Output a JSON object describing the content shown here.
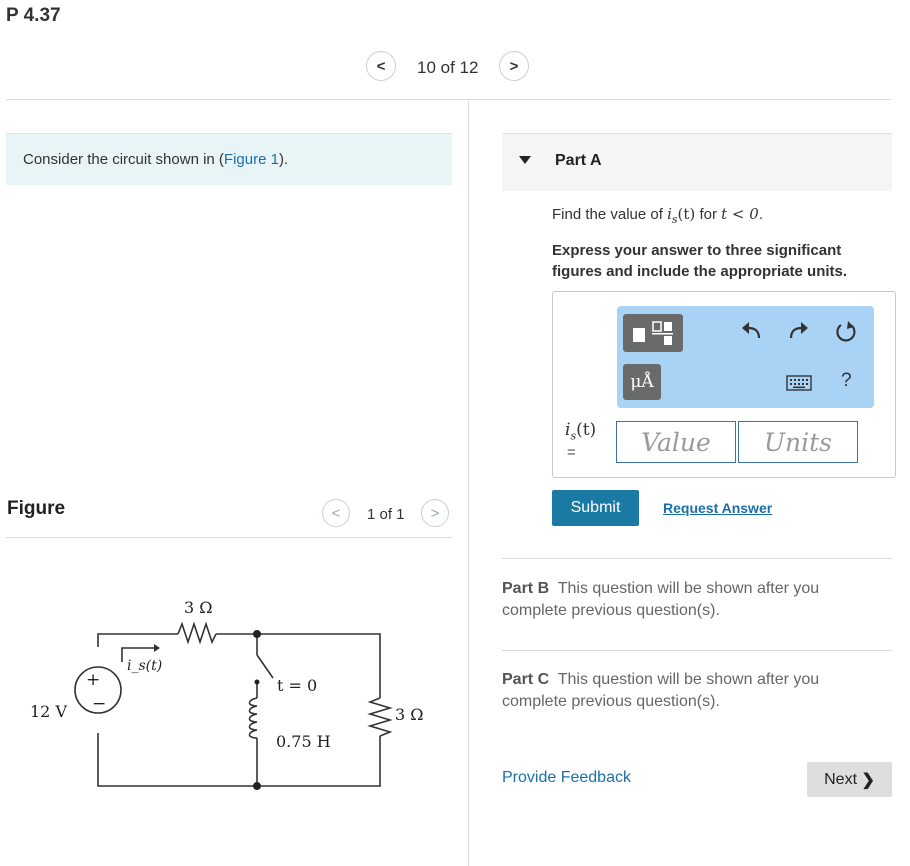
{
  "problem": {
    "id": "P 4.37"
  },
  "pager": {
    "prev_symbol": "<",
    "text": "10 of 12",
    "next_symbol": ">"
  },
  "intro": {
    "text_before": "Consider the circuit shown in (",
    "link_text": "Figure 1",
    "text_after": ")."
  },
  "figure": {
    "label": "Figure",
    "pager": {
      "prev_symbol": "<",
      "text": "1 of 1",
      "next_symbol": ">"
    },
    "circuit": {
      "source_label": "12 V",
      "source_plus": "+",
      "source_minus": "−",
      "current_label": "i_s(t)",
      "r1_label": "3 Ω",
      "switch_label": "t = 0",
      "inductor_label": "0.75 H",
      "r2_label": "3 Ω"
    }
  },
  "part_a": {
    "title": "Part A",
    "question_prefix": "Find the value of ",
    "question_var": "i",
    "question_sub": "s",
    "question_arg": "(t)",
    "question_mid": " for ",
    "question_cond": "t < 0",
    "question_end": ".",
    "instructions": "Express your answer to three significant figures and include the appropriate units.",
    "toolbar": {
      "units_symbol": "μÅ",
      "help_symbol": "?"
    },
    "answer_label": "i",
    "answer_sub": "s",
    "answer_arg": "(t)",
    "answer_eq": "=",
    "value_placeholder": "Value",
    "units_placeholder": "Units",
    "submit_label": "Submit",
    "request_label": "Request Answer"
  },
  "part_b": {
    "title": "Part B",
    "text": "This question will be shown after you complete previous question(s)."
  },
  "part_c": {
    "title": "Part C",
    "text": "This question will be shown after you complete previous question(s)."
  },
  "footer": {
    "feedback_label": "Provide Feedback",
    "next_label": "Next",
    "next_symbol": "❯"
  },
  "colors": {
    "accent": "#1b7aa4",
    "link": "#1a6fa8",
    "toolbar_bg": "#a9d3f5",
    "intro_bg": "#e9f4f6"
  }
}
